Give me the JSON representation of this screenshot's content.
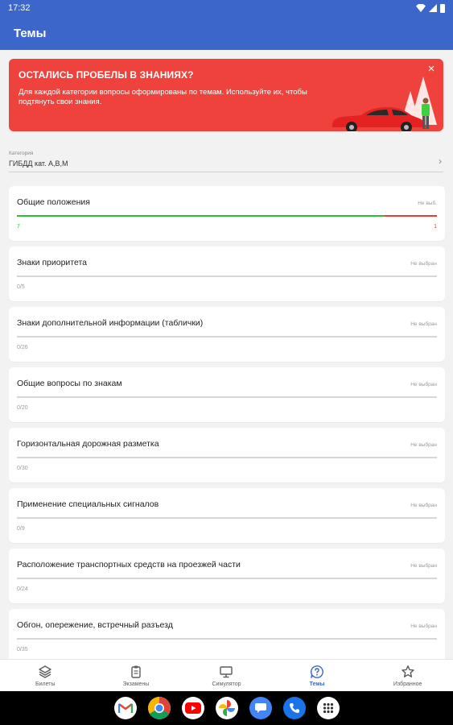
{
  "status_bar": {
    "time": "17:32"
  },
  "app_bar": {
    "title": "Темы"
  },
  "banner": {
    "title": "ОСТАЛИСЬ ПРОБЕЛЫ В ЗНАНИЯХ?",
    "text": "Для каждой категории вопросы оформированы по темам. Используйте их, чтобы подтянуть свои знания.",
    "close_icon": "×"
  },
  "category": {
    "label": "Категория",
    "value": "ГИБДД кат. A,B,M",
    "chevron": "›"
  },
  "topics": [
    {
      "title": "Общие положения",
      "status": "Не выб.",
      "correct": "7",
      "wrong": "1",
      "correct_fraction": 0.875,
      "wrong_fraction": 0.125
    },
    {
      "title": "Знаки приоритета",
      "status": "Не выбран",
      "progress": "0/5"
    },
    {
      "title": "Знаки дополнительной информации (таблички)",
      "status": "Не выбран",
      "progress": "0/26"
    },
    {
      "title": "Общие вопросы по знакам",
      "status": "Не выбран",
      "progress": "0/20"
    },
    {
      "title": "Горизонтальная дорожная разметка",
      "status": "Не выбран",
      "progress": "0/30"
    },
    {
      "title": "Применение специальных сигналов",
      "status": "Не выбран",
      "progress": "0/9"
    },
    {
      "title": "Расположение транспортных средств на проезжей части",
      "status": "Не выбран",
      "progress": "0/24"
    },
    {
      "title": "Обгон, опережение, встречный разъезд",
      "status": "Не выбран",
      "progress": "0/35"
    }
  ],
  "bottom_nav": [
    {
      "label": "Билеты",
      "icon": "layers-icon"
    },
    {
      "label": "Экзамены",
      "icon": "clipboard-icon"
    },
    {
      "label": "Симулятор",
      "icon": "monitor-icon"
    },
    {
      "label": "Темы",
      "icon": "question-icon",
      "active": true
    },
    {
      "label": "Избранное",
      "icon": "star-icon"
    }
  ],
  "taskbar": [
    "gmail-icon",
    "chrome-icon",
    "youtube-icon",
    "photos-icon",
    "messages-icon",
    "phone-icon",
    "apps-icon"
  ],
  "colors": {
    "primary": "#3c66c9",
    "banner": "#f0423c",
    "correct": "#2ebd35",
    "wrong": "#e83b3b"
  }
}
